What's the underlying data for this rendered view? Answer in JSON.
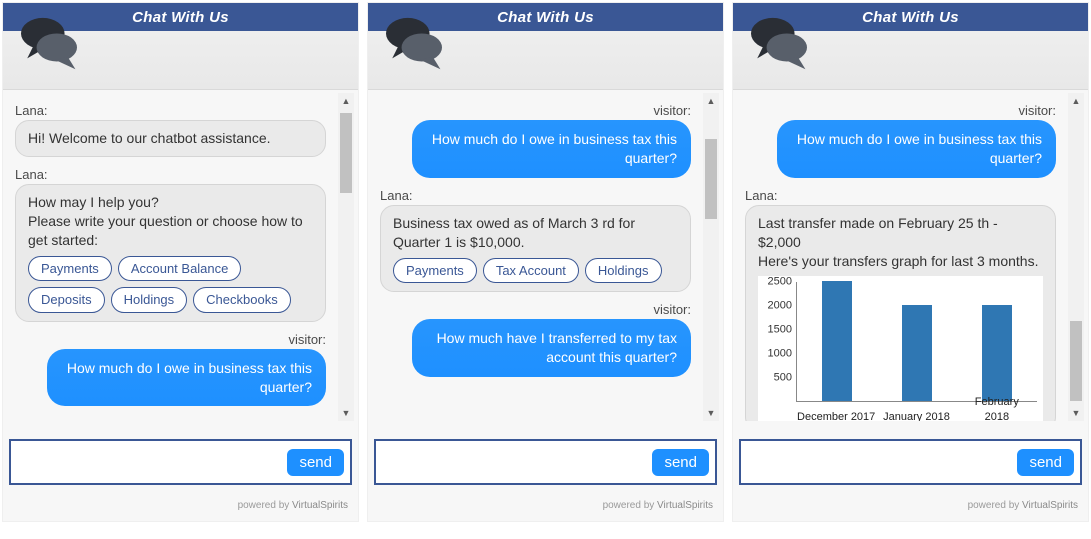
{
  "header": {
    "title": "Chat With Us"
  },
  "footer": {
    "powered_prefix": "powered by ",
    "powered_brand": "VirtualSpirits"
  },
  "input": {
    "placeholder": "",
    "send_label": "send"
  },
  "labels": {
    "bot_name": "Lana:",
    "visitor_name": "visitor:"
  },
  "panel1": {
    "bot_msg_1": "Hi! Welcome to our chatbot assistance.",
    "bot_msg_2": "How may I help you?\nPlease write your question or choose how to get started:",
    "chips": [
      "Payments",
      "Account Balance",
      "Deposits",
      "Holdings",
      "Checkbooks"
    ],
    "visitor_msg": "How much do I owe in business tax this quarter?"
  },
  "panel2": {
    "visitor_msg_1": "How much do I owe in business tax this quarter?",
    "bot_msg": "Business tax owed as of March 3 rd for Quarter 1 is $10,000.",
    "chips": [
      "Payments",
      "Tax Account",
      "Holdings"
    ],
    "visitor_msg_2": "How much have I transferred to my tax account this quarter?"
  },
  "panel3": {
    "visitor_msg": "How much do I owe in business tax this quarter?",
    "bot_msg": "Last transfer made on February 25 th - $2,000\nHere's your transfers graph for last 3 months."
  },
  "chart_data": {
    "type": "bar",
    "title": "",
    "xlabel": "",
    "ylabel": "",
    "ylim": [
      0,
      2500
    ],
    "yticks": [
      500,
      1000,
      1500,
      2000,
      2500
    ],
    "categories": [
      "December 2017",
      "January 2018",
      "February 2018"
    ],
    "values": [
      2500,
      2000,
      2000
    ]
  }
}
